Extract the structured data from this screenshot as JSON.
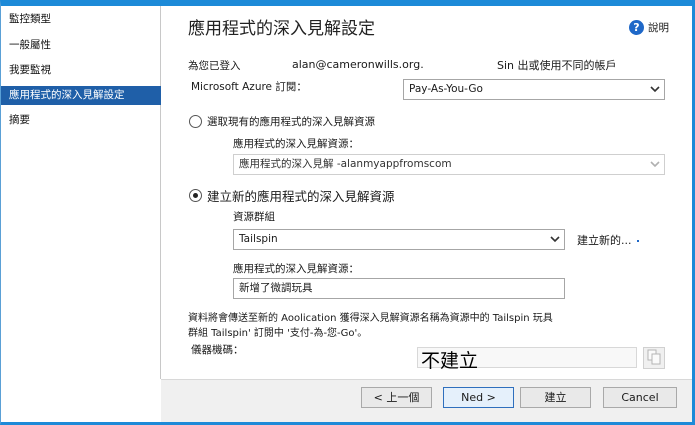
{
  "sidebar": {
    "items": [
      {
        "label": "監控類型",
        "active": false
      },
      {
        "label": "一般屬性",
        "active": false
      },
      {
        "label": "我要監視",
        "active": false
      },
      {
        "label": "應用程式的深入見解設定",
        "active": true
      },
      {
        "label": "摘要",
        "active": false
      }
    ]
  },
  "header": {
    "title": "應用程式的深入見解設定",
    "help_label": "說明",
    "help_icon": "help-icon"
  },
  "account": {
    "signed_in_label": "為您已登入",
    "email": "alan@cameronwills.org.",
    "switch_link": "Sin 出或使用不同的帳戶"
  },
  "subscription": {
    "label": "Microsoft Azure 訂閱：",
    "value": "Pay-As-You-Go"
  },
  "existing": {
    "radio_label": "選取現有的應用程式的深入見解資源",
    "selected": false,
    "resource_label": "應用程式的深入見解資源：",
    "resource_value": "應用程式的深入見解 -alanmyappfromscom"
  },
  "create_new": {
    "radio_label": "建立新的應用程式的深入見解資源",
    "selected": true,
    "group_label": "資源群組",
    "group_value": "Tailspin",
    "group_new_link": "建立新的...",
    "resource_label": "應用程式的深入見解資源：",
    "resource_value": "新增了微調玩具"
  },
  "info": {
    "text": "資料將會傳送至新的 Aoolication 獲得深入見解資源名稱為資源中的 Tailspin 玩具群組 Tailspin' 訂閱中 '支付-為-您-Go'。",
    "machine_code_label": "儀器機碼：",
    "machine_code_value": "不建立"
  },
  "footer": {
    "prev_label": "< 上一個",
    "next_label": "Ned >",
    "create_label": "建立",
    "cancel_label": "Cancel"
  }
}
